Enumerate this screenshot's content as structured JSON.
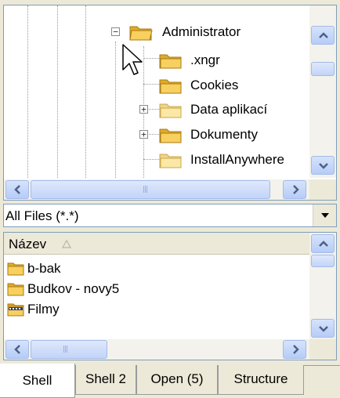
{
  "tree": {
    "items": [
      {
        "label": "Administrator",
        "expander": "minus"
      },
      {
        "label": ".xngr"
      },
      {
        "label": "Cookies"
      },
      {
        "label": "Data aplikací",
        "expander": "plus"
      },
      {
        "label": "Dokumenty",
        "expander": "plus"
      },
      {
        "label": "InstallAnywhere"
      }
    ]
  },
  "filter": {
    "value": "All Files (*.*)"
  },
  "list": {
    "header": "Název",
    "items": [
      {
        "label": "b-bak",
        "icon": "folder-icon"
      },
      {
        "label": "Budkov - novy5",
        "icon": "folder-icon"
      },
      {
        "label": "Filmy",
        "icon": "film-folder-icon"
      }
    ]
  },
  "tabs": [
    {
      "label": "Shell",
      "active": true
    },
    {
      "label": "Shell 2"
    },
    {
      "label": "Open (5)"
    },
    {
      "label": "Structure"
    }
  ],
  "colors": {
    "folder": "#f5c542",
    "folder_faded": "#fbe7a6",
    "scroll_button": "#c6d7f9",
    "border": "#7f9db9"
  }
}
